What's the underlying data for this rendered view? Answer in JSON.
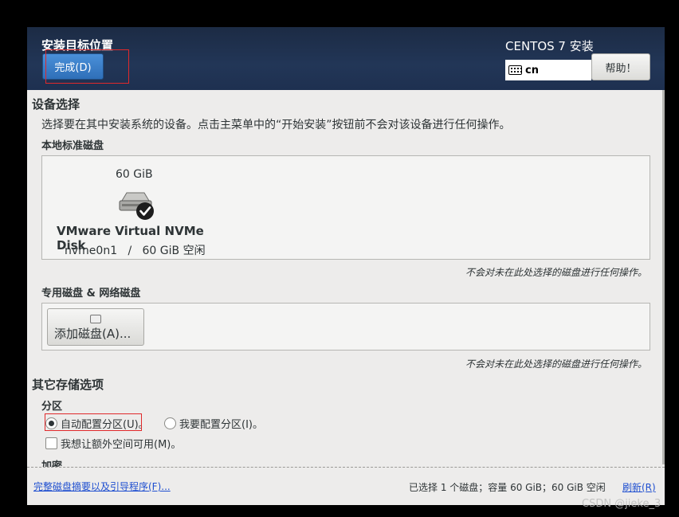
{
  "header": {
    "title": "安装目标位置",
    "done_label": "完成(D)",
    "product": "CENTOS 7 安装",
    "keyboard_layout": "cn",
    "help_label": "帮助！"
  },
  "device_selection": {
    "title": "设备选择",
    "description": "选择要在其中安装系统的设备。点击主菜单中的“开始安装”按钮前不会对该设备进行任何操作。",
    "local_title": "本地标准磁盘",
    "disk": {
      "size": "60 GiB",
      "name": "VMware Virtual NVMe Disk",
      "info": "nvme0n1   /   60 GiB 空闲",
      "selected": true
    },
    "local_note": "不会对未在此处选择的磁盘进行任何操作。",
    "special_title": "专用磁盘 & 网络磁盘",
    "add_disk_label": "添加磁盘(A)...",
    "special_note": "不会对未在此处选择的磁盘进行任何操作。"
  },
  "other_storage": {
    "title": "其它存储选项",
    "partition_title": "分区",
    "auto_partition": "自动配置分区(U)。",
    "manual_partition": "我要配置分区(I)。",
    "extra_space": "我想让额外空间可用(M)。",
    "encryption_title": "加密"
  },
  "footer": {
    "summary_link": "完整磁盘摘要以及引导程序(F)...",
    "status": "已选择 1 个磁盘；容量 60 GiB；60 GiB 空闲",
    "refresh": "刷新(R)"
  },
  "watermark": "CSDN @jieke_3",
  "colors": {
    "header_bg": "#223657",
    "accent": "#2f6fb8",
    "link": "#1f4fd0",
    "highlight_box": "#e0292b"
  }
}
